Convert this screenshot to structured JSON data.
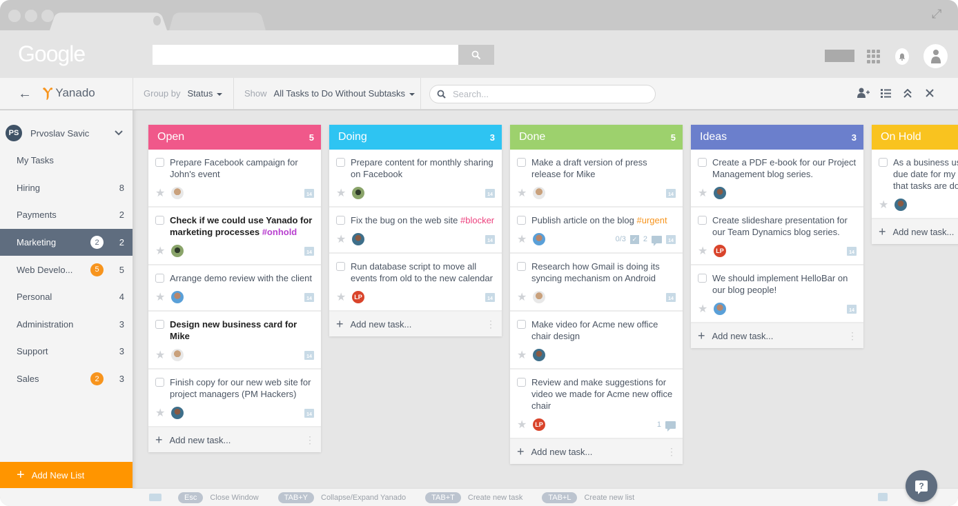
{
  "browser": {
    "google_logo": "Google",
    "search_placeholder": ""
  },
  "toolbar": {
    "app_name": "Yanado",
    "group_by_label": "Group by",
    "group_by_value": "Status",
    "show_label": "Show",
    "show_value": "All Tasks to Do Without Subtasks",
    "search_placeholder": "Search..."
  },
  "sidebar": {
    "user": {
      "initials": "PS",
      "name": "Prvoslav Savic"
    },
    "items": [
      {
        "label": "My Tasks",
        "badge": null,
        "count": ""
      },
      {
        "label": "Hiring",
        "badge": null,
        "count": "8"
      },
      {
        "label": "Payments",
        "badge": null,
        "count": "2"
      },
      {
        "label": "Marketing",
        "badge": "2",
        "count": "2",
        "active": true
      },
      {
        "label": "Web Develo...",
        "badge": "5",
        "count": "5"
      },
      {
        "label": "Personal",
        "badge": null,
        "count": "4"
      },
      {
        "label": "Administration",
        "badge": null,
        "count": "3"
      },
      {
        "label": "Support",
        "badge": null,
        "count": "3"
      },
      {
        "label": "Sales",
        "badge": "2",
        "count": "3"
      }
    ],
    "add_list_label": "Add New List"
  },
  "board": {
    "add_task_label": "Add new task...",
    "columns": [
      {
        "title": "Open",
        "count": "5",
        "color": "#f0588a",
        "tasks": [
          {
            "text": "Prepare Facebook campaign for John's event",
            "bold": false,
            "tag": "",
            "tag_color": "",
            "avatar": "p1",
            "date": "14"
          },
          {
            "text": "Check if we could use Yanado for marketing processes",
            "bold": true,
            "tag": "#onhold",
            "tag_color": "#b83fcf",
            "avatar": "p2",
            "date": "14"
          },
          {
            "text": "Arrange demo review with the client",
            "bold": false,
            "tag": "",
            "tag_color": "",
            "avatar": "p3",
            "date": "14"
          },
          {
            "text": "Design new business card for Mike",
            "bold": true,
            "tag": "",
            "tag_color": "",
            "avatar": "p1",
            "date": "14"
          },
          {
            "text": "Finish copy for our new web site for project managers (PM Hackers)",
            "bold": false,
            "tag": "",
            "tag_color": "",
            "avatar": "p4",
            "date": "14"
          }
        ]
      },
      {
        "title": "Doing",
        "count": "3",
        "color": "#2ec4f2",
        "tasks": [
          {
            "text": "Prepare content for monthly sharing on Facebook",
            "bold": false,
            "tag": "",
            "tag_color": "",
            "avatar": "p2",
            "date": "14"
          },
          {
            "text": "Fix the bug on the web site",
            "bold": false,
            "tag": "#blocker",
            "tag_color": "#ec3f7c",
            "avatar": "p4",
            "date": "14"
          },
          {
            "text": "Run database script to move all events from old to the new calendar",
            "bold": false,
            "tag": "",
            "tag_color": "",
            "avatar": "LP",
            "date": "14"
          }
        ]
      },
      {
        "title": "Done",
        "count": "5",
        "color": "#9dd16d",
        "tasks": [
          {
            "text": "Make a draft version of press release for Mike",
            "bold": false,
            "tag": "",
            "tag_color": "",
            "avatar": "p1",
            "date": "14"
          },
          {
            "text": "Publish article on the blog",
            "bold": false,
            "tag": "#urgent",
            "tag_color": "#f7941d",
            "avatar": "p3",
            "date": "14",
            "checklist": "0/3",
            "comments": "2"
          },
          {
            "text": "Research how Gmail is doing its syncing mechanism on Android",
            "bold": false,
            "tag": "",
            "tag_color": "",
            "avatar": "p1",
            "date": "14"
          },
          {
            "text": "Make video for Acme new office chair design",
            "bold": false,
            "tag": "",
            "tag_color": "",
            "avatar": "p4",
            "date": ""
          },
          {
            "text": "Review and make suggestions for video we made for Acme new office chair",
            "bold": false,
            "tag": "",
            "tag_color": "",
            "avatar": "LP",
            "date": "",
            "comments": "1"
          }
        ]
      },
      {
        "title": "Ideas",
        "count": "3",
        "color": "#6b7fcc",
        "tasks": [
          {
            "text": "Create a PDF e-book for our Project Management blog series.",
            "bold": false,
            "tag": "",
            "tag_color": "",
            "avatar": "p4",
            "date": ""
          },
          {
            "text": "Create slideshare presentation for our Team Dynamics blog series.",
            "bold": false,
            "tag": "",
            "tag_color": "",
            "avatar": "LP",
            "date": "14"
          },
          {
            "text": "We should implement HelloBar on our blog people!",
            "bold": false,
            "tag": "",
            "tag_color": "",
            "avatar": "p3",
            "date": "14"
          }
        ]
      },
      {
        "title": "On Hold",
        "count": "",
        "color": "#f9c31f",
        "tasks": [
          {
            "text": "As a business user I want to set a due date for my task, to make sure that tasks are done on time",
            "bold": false,
            "tag": "",
            "tag_color": "",
            "avatar": "p4",
            "date": ""
          }
        ]
      }
    ]
  },
  "shortcuts": [
    {
      "key": "Esc",
      "label": "Close Window"
    },
    {
      "key": "TAB+Y",
      "label": "Collapse/Expand Yanado"
    },
    {
      "key": "TAB+T",
      "label": "Create new task"
    },
    {
      "key": "TAB+L",
      "label": "Create new list"
    }
  ],
  "help_button": "?"
}
